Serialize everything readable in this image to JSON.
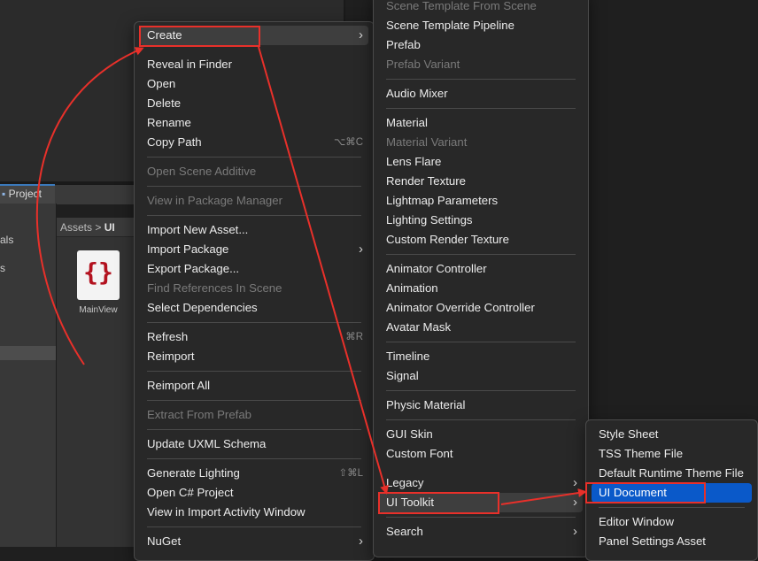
{
  "background": {
    "project_tab_label": "Project",
    "left_panel_items": [
      "als",
      "s"
    ],
    "breadcrumb_root": "Assets",
    "breadcrumb_sep": ">",
    "breadcrumb_current": "UI",
    "asset_file_icon_glyph": "{}",
    "asset_file_name": "MainView"
  },
  "context_menu": {
    "items": [
      {
        "label": "Create",
        "submenu": true,
        "highlighted": true
      },
      {
        "label": "Reveal in Finder"
      },
      {
        "label": "Open"
      },
      {
        "label": "Delete"
      },
      {
        "label": "Rename"
      },
      {
        "label": "Copy Path",
        "shortcut": "⌥⌘C"
      },
      {
        "label": "Open Scene Additive",
        "disabled": true
      },
      {
        "label": "View in Package Manager",
        "disabled": true
      },
      {
        "label": "Import New Asset..."
      },
      {
        "label": "Import Package",
        "submenu": true
      },
      {
        "label": "Export Package..."
      },
      {
        "label": "Find References In Scene",
        "disabled": true
      },
      {
        "label": "Select Dependencies"
      },
      {
        "label": "Refresh",
        "shortcut": "⌘R"
      },
      {
        "label": "Reimport"
      },
      {
        "label": "Reimport All"
      },
      {
        "label": "Extract From Prefab",
        "disabled": true
      },
      {
        "label": "Update UXML Schema"
      },
      {
        "label": "Generate Lighting",
        "shortcut": "⇧⌘L"
      },
      {
        "label": "Open C# Project"
      },
      {
        "label": "View in Import Activity Window"
      },
      {
        "label": "NuGet",
        "submenu": true
      }
    ]
  },
  "create_submenu": {
    "items": [
      {
        "label": "Scene Template From Scene",
        "disabled": true
      },
      {
        "label": "Scene Template Pipeline"
      },
      {
        "label": "Prefab"
      },
      {
        "label": "Prefab Variant",
        "disabled": true
      },
      {
        "label": "Audio Mixer"
      },
      {
        "label": "Material"
      },
      {
        "label": "Material Variant",
        "disabled": true
      },
      {
        "label": "Lens Flare"
      },
      {
        "label": "Render Texture"
      },
      {
        "label": "Lightmap Parameters"
      },
      {
        "label": "Lighting Settings"
      },
      {
        "label": "Custom Render Texture"
      },
      {
        "label": "Animator Controller"
      },
      {
        "label": "Animation"
      },
      {
        "label": "Animator Override Controller"
      },
      {
        "label": "Avatar Mask"
      },
      {
        "label": "Timeline"
      },
      {
        "label": "Signal"
      },
      {
        "label": "Physic Material"
      },
      {
        "label": "GUI Skin"
      },
      {
        "label": "Custom Font"
      },
      {
        "label": "Legacy",
        "submenu": true
      },
      {
        "label": "UI Toolkit",
        "submenu": true,
        "highlighted": true
      },
      {
        "label": "Search",
        "submenu": true
      }
    ]
  },
  "ui_toolkit_submenu": {
    "items": [
      {
        "label": "Style Sheet"
      },
      {
        "label": "TSS Theme File"
      },
      {
        "label": "Default Runtime Theme File"
      },
      {
        "label": "UI Document",
        "selected": true
      },
      {
        "label": "Editor Window"
      },
      {
        "label": "Panel Settings Asset"
      }
    ]
  },
  "glyphs": {
    "submenu_arrow": "›"
  },
  "colors": {
    "annotation_red": "#e8302a",
    "selection_blue": "#0a59c9",
    "menu_bg": "#282828"
  }
}
